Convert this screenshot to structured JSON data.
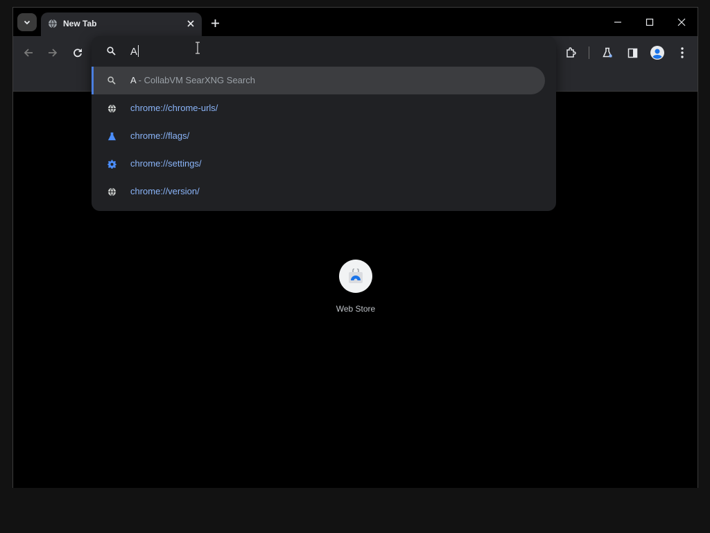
{
  "tab": {
    "title": "New Tab"
  },
  "omnibox": {
    "typed": "A"
  },
  "suggestions": [
    {
      "kind": "search",
      "query": "A",
      "separator": "-",
      "engine": "CollabVM SearXNG Search",
      "icon": "search-icon"
    },
    {
      "kind": "url",
      "text": "chrome://chrome-urls/",
      "icon": "globe-icon"
    },
    {
      "kind": "url",
      "text": "chrome://flags/",
      "icon": "flask-icon"
    },
    {
      "kind": "url",
      "text": "chrome://settings/",
      "icon": "gear-icon"
    },
    {
      "kind": "url",
      "text": "chrome://version/",
      "icon": "globe-icon"
    }
  ],
  "shortcut": {
    "label": "Web Store"
  },
  "colors": {
    "accent": "#8ab4f8",
    "selected_bar": "#4b7fe0",
    "toolbar": "#28292d"
  }
}
